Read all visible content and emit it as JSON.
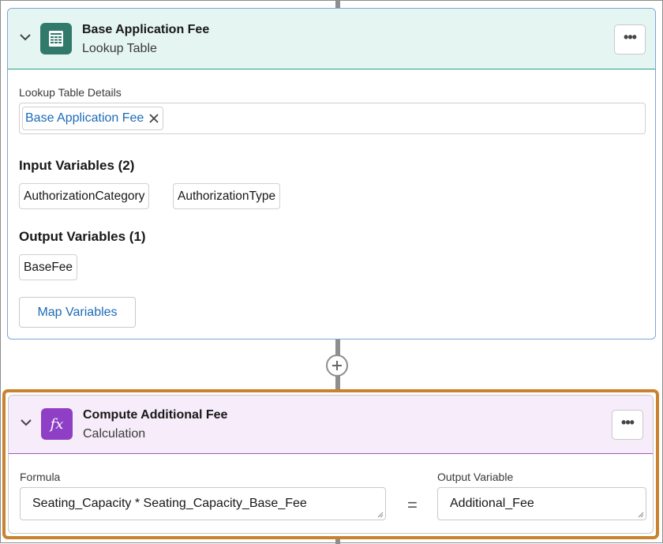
{
  "lookup_node": {
    "title": "Base Application Fee",
    "subtitle": "Lookup Table",
    "icon": "table-icon",
    "details_label": "Lookup Table Details",
    "selected_table": "Base Application Fee",
    "input_heading": "Input Variables (2)",
    "inputs": [
      "AuthorizationCategory",
      "AuthorizationType"
    ],
    "output_heading": "Output Variables (1)",
    "outputs": [
      "BaseFee"
    ],
    "map_button": "Map Variables"
  },
  "calc_node": {
    "title": "Compute Additional Fee",
    "subtitle": "Calculation",
    "icon": "formula-fx-icon",
    "icon_text": "fx",
    "formula_label": "Formula",
    "formula_value": "Seating_Capacity * Seating_Capacity_Base_Fee",
    "equals": "=",
    "output_label": "Output Variable",
    "output_value": "Additional_Fee"
  },
  "colors": {
    "lookup_accent": "#317a6b",
    "calc_accent": "#8e3fc6",
    "selection_outline": "#c9822d",
    "link": "#1c6bb8"
  }
}
